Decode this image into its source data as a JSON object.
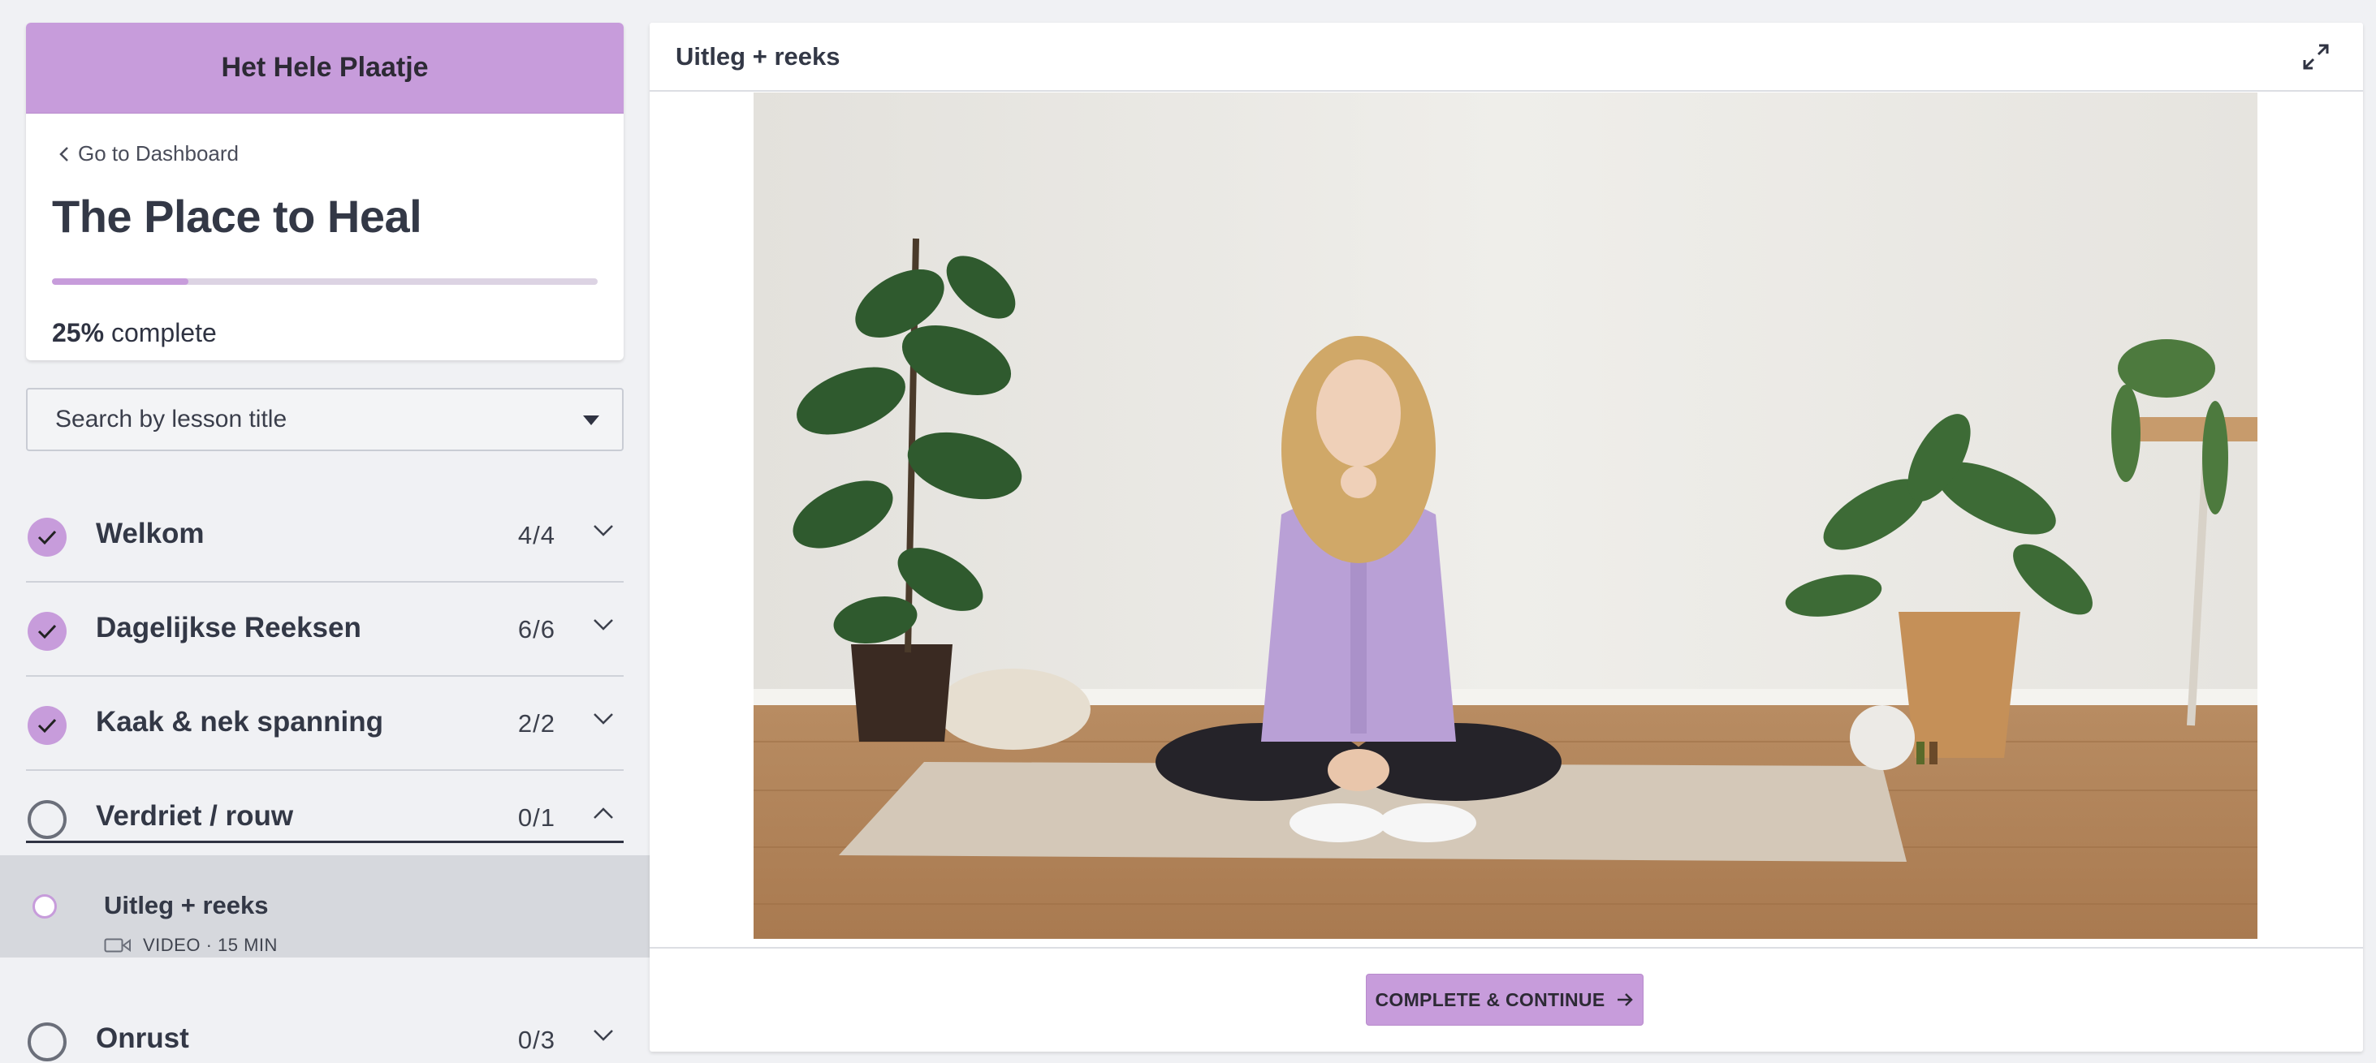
{
  "school": {
    "name": "Het Hele Plaatje"
  },
  "course": {
    "back_label": "Go to Dashboard",
    "title": "The Place to Heal",
    "progress_percent": 25,
    "progress_value": "25%",
    "progress_suffix": "complete"
  },
  "search": {
    "placeholder": "Search by lesson title"
  },
  "chapters": [
    {
      "title": "Welkom",
      "count": "4/4",
      "completed": true,
      "expanded": false
    },
    {
      "title": "Dagelijkse Reeksen",
      "count": "6/6",
      "completed": true,
      "expanded": false
    },
    {
      "title": "Kaak & nek spanning",
      "count": "2/2",
      "completed": true,
      "expanded": false
    },
    {
      "title": "Verdriet / rouw",
      "count": "0/1",
      "completed": false,
      "expanded": true
    },
    {
      "title": "Onrust",
      "count": "0/3",
      "completed": false,
      "expanded": false
    }
  ],
  "active_lesson": {
    "title": "Uitleg + reeks",
    "meta": "VIDEO · 15 MIN"
  },
  "main": {
    "header_title": "Uitleg + reeks",
    "cta_label": "COMPLETE & CONTINUE"
  },
  "colors": {
    "accent": "#c79cdb",
    "text": "#333846",
    "background": "#f0f1f4"
  },
  "icons": [
    "chevron-left-icon",
    "caret-down-icon",
    "check-icon",
    "chevron-down-icon",
    "chevron-up-icon",
    "video-camera-icon",
    "expand-icon",
    "arrow-right-icon"
  ]
}
